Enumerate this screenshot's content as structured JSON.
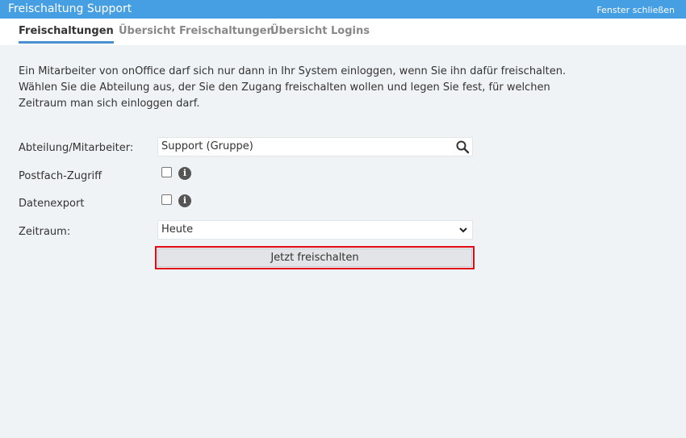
{
  "window": {
    "title": "Freischaltung Support",
    "close_label": "Fenster schließen"
  },
  "tabs": [
    {
      "label": "Freischaltungen",
      "active": true
    },
    {
      "label": "Übersicht Freischaltungen",
      "active": false
    },
    {
      "label": "Übersicht Logins",
      "active": false
    }
  ],
  "intro": "Ein Mitarbeiter von onOffice darf sich nur dann in Ihr System einloggen, wenn Sie ihn dafür freischalten. Wählen Sie die Abteilung aus, der Sie den Zugang freischalten wollen und legen Sie fest, für welchen Zeitraum man sich einloggen darf.",
  "form": {
    "department": {
      "label": "Abteilung/Mitarbeiter:",
      "value": "Support (Gruppe)",
      "icon": "search-icon"
    },
    "mailbox": {
      "label": "Postfach-Zugriff",
      "checked": false,
      "icon": "info-icon"
    },
    "export": {
      "label": "Datenexport",
      "checked": false,
      "icon": "info-icon"
    },
    "period": {
      "label": "Zeitraum:",
      "value": "Heute",
      "icon": "chevron-down-icon"
    },
    "submit_label": "Jetzt freischalten"
  },
  "colors": {
    "titlebar": "#479fe3",
    "active_tab_underline": "#4a8fcf",
    "highlight_border": "#e00a16",
    "background": "#f0f3f6"
  }
}
